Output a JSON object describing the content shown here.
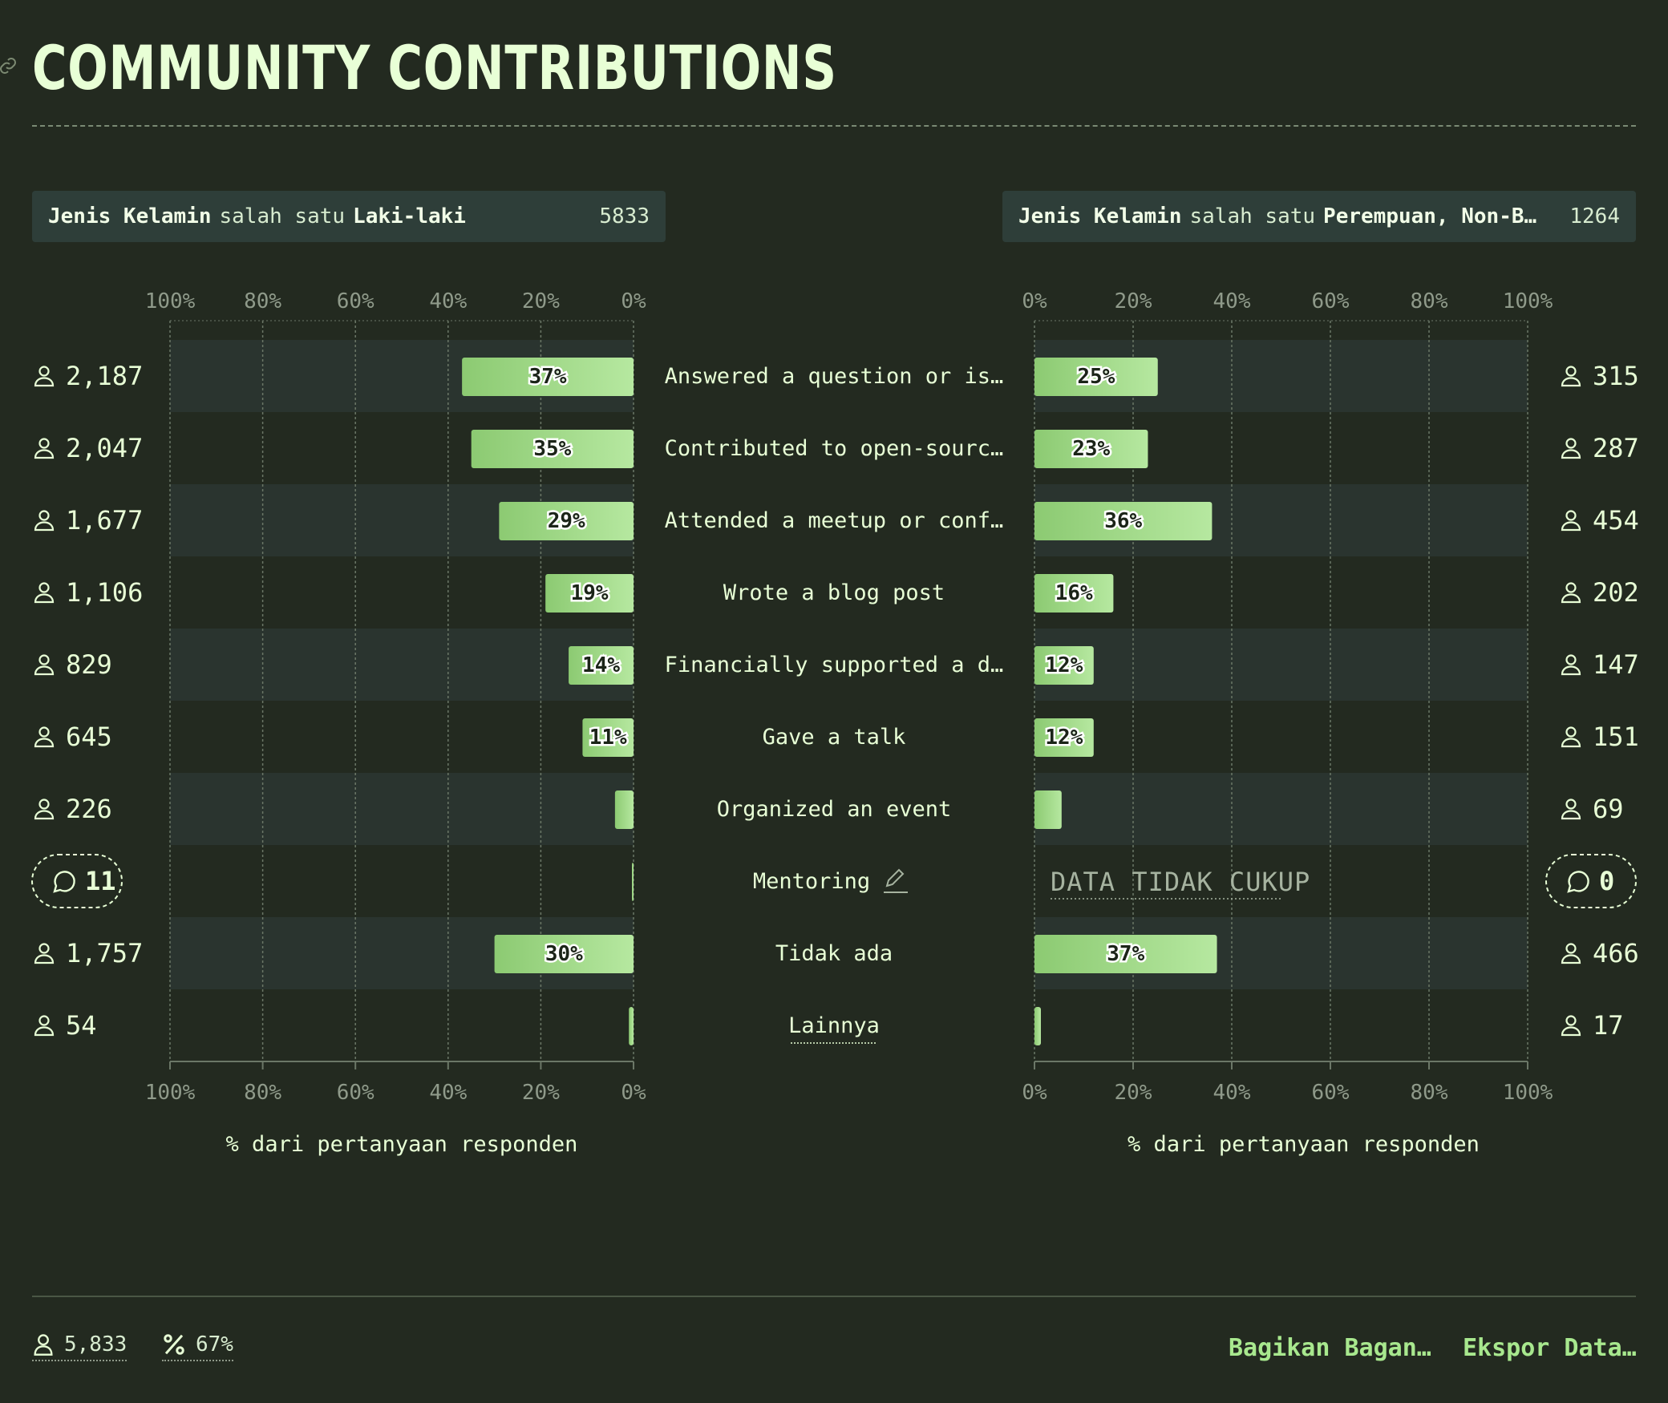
{
  "title": "COMMUNITY CONTRIBUTIONS",
  "filters": {
    "left": {
      "field": "Jenis Kelamin",
      "op": "salah satu",
      "value": "Laki-laki",
      "count": "5833"
    },
    "right": {
      "field": "Jenis Kelamin",
      "op": "salah satu",
      "value": "Perempuan, Non-B…",
      "count": "1264"
    }
  },
  "chart_data": {
    "type": "bar",
    "layout": "butterfly",
    "categories": [
      "Answered a question or is…",
      "Contributed to open-sourc…",
      "Attended a meetup or conf…",
      "Wrote a blog post",
      "Financially supported a d…",
      "Gave a talk",
      "Organized an event",
      "Mentoring",
      "Tidak ada",
      "Lainnya"
    ],
    "series": [
      {
        "values": [
          37,
          35,
          29,
          19,
          14,
          11,
          4,
          0.2,
          30,
          1
        ],
        "labels": [
          "37%",
          "35%",
          "29%",
          "19%",
          "14%",
          "11%",
          "",
          "",
          "30%",
          ""
        ],
        "counts": [
          "2,187",
          "2,047",
          "1,677",
          "1,106",
          "829",
          "645",
          "226",
          "11",
          "1,757",
          "54"
        ]
      },
      {
        "values": [
          25,
          23,
          36,
          16,
          12,
          12,
          5.5,
          null,
          37,
          1.3
        ],
        "labels": [
          "25%",
          "23%",
          "36%",
          "16%",
          "12%",
          "12%",
          "",
          "",
          "37%",
          ""
        ],
        "counts": [
          "315",
          "287",
          "454",
          "202",
          "147",
          "151",
          "69",
          "0",
          "466",
          "17"
        ]
      }
    ],
    "xlim": [
      0,
      100
    ],
    "ticks": [
      "0%",
      "20%",
      "40%",
      "60%",
      "80%",
      "100%"
    ],
    "xlabel": "% dari pertanyaan responden",
    "insufficient_label": "DATA TIDAK CUKUP",
    "comment_rows": [
      7
    ],
    "editable_rows": [
      7
    ],
    "link_rows": [
      9
    ],
    "colors": {
      "bar_start": "#8cca72",
      "bar_end": "#b6e8a0",
      "band": "#2a342f",
      "grid": "#6b7767"
    }
  },
  "footer": {
    "total_users": "5,833",
    "percent": "67%",
    "share_label": "Bagikan Bagan…",
    "export_label": "Ekspor Data…"
  }
}
